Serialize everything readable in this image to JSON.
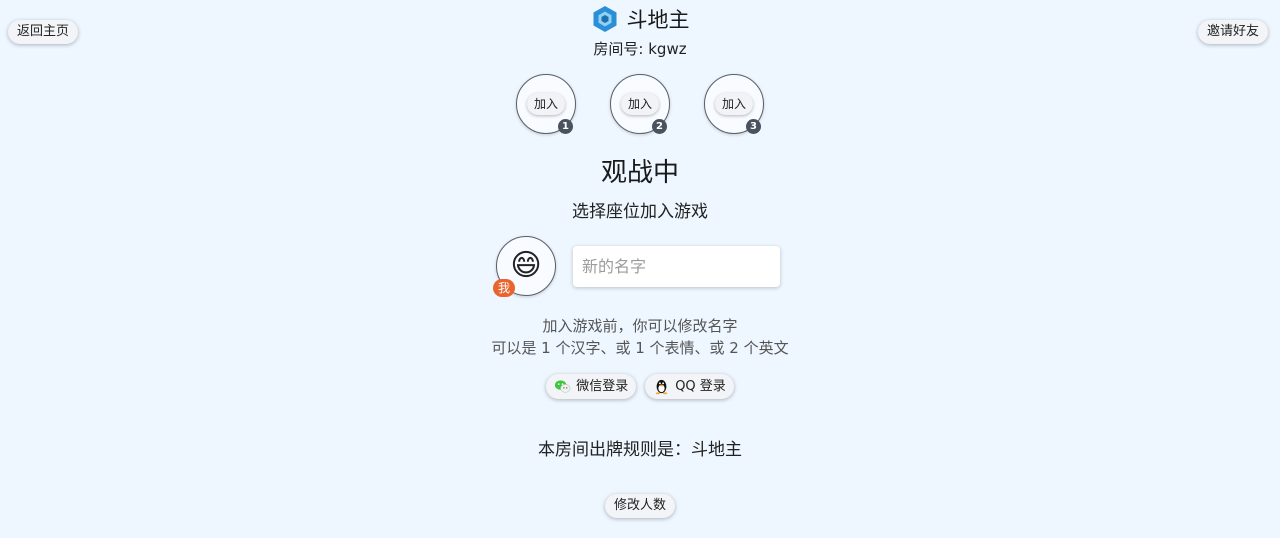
{
  "nav": {
    "back_label": "返回主页",
    "invite_label": "邀请好友"
  },
  "header": {
    "title": "斗地主",
    "room_prefix": "房间号: ",
    "room_code": "kgwz",
    "logo_icon": "hexagon-logo-icon",
    "logo_color": "#2a8fd6"
  },
  "seats": [
    {
      "join_label": "加入",
      "number": "1"
    },
    {
      "join_label": "加入",
      "number": "2"
    },
    {
      "join_label": "加入",
      "number": "3"
    }
  ],
  "status": {
    "title": "观战中",
    "subtitle": "选择座位加入游戏"
  },
  "profile": {
    "avatar_emoji": "😄",
    "me_badge": "我",
    "badge_color": "#e9642e",
    "name_placeholder": "新的名字",
    "name_value": ""
  },
  "hint": {
    "line1": "加入游戏前，你可以修改名字",
    "line2": "可以是 1 个汉字、或 1 个表情、或 2 个英文"
  },
  "login": {
    "wechat_label": "微信登录",
    "wechat_icon": "wechat-icon",
    "qq_label": "QQ 登录",
    "qq_icon": "qq-penguin-icon"
  },
  "rules": {
    "line": "本房间出牌规则是：斗地主"
  },
  "actions": {
    "change_count_label": "修改人数"
  }
}
